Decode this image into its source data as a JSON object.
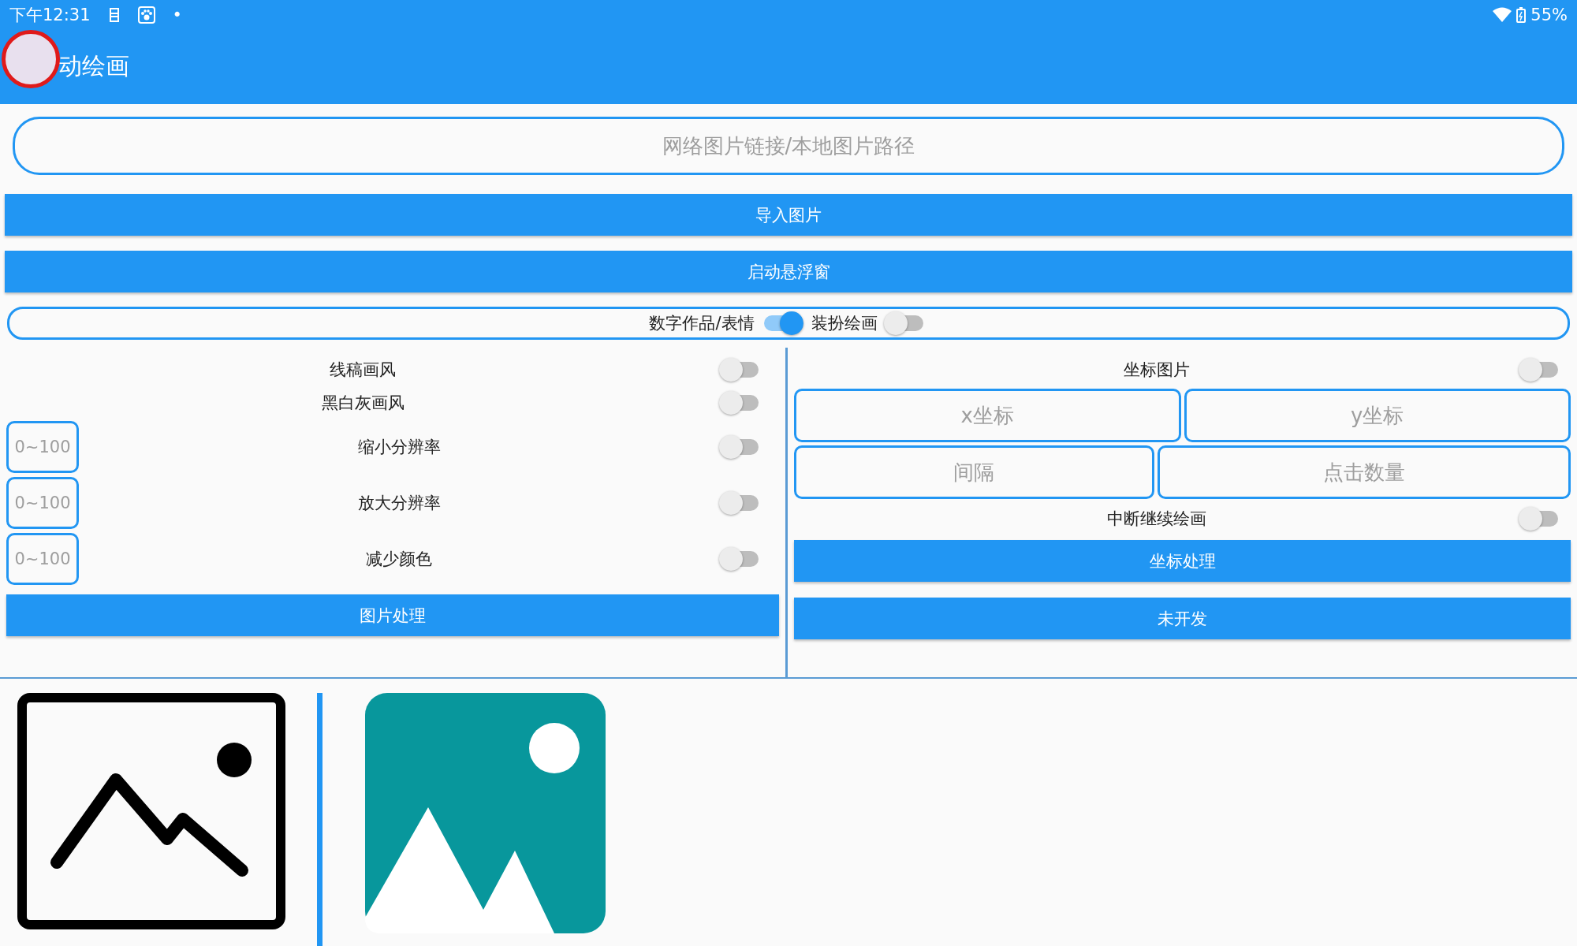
{
  "status_bar": {
    "time": "下午12:31",
    "dot": "•",
    "battery": "55%"
  },
  "app_bar": {
    "title": "动绘画"
  },
  "url_field": {
    "placeholder": "网络图片链接/本地图片路径"
  },
  "buttons": [
    "导入图片",
    "启动悬浮窗"
  ],
  "mode_row": [
    {
      "label": "数字作品/表情",
      "on": true
    },
    {
      "label": "装扮绘画",
      "on": false
    }
  ],
  "left_panel": {
    "rows": [
      {
        "kind": "switch",
        "label": "线稿画风",
        "on": false
      },
      {
        "kind": "switch",
        "label": "黑白灰画风",
        "on": false
      },
      {
        "kind": "input",
        "placeholder": "0~100",
        "label": "缩小分辨率",
        "on": false
      },
      {
        "kind": "input",
        "placeholder": "0~100",
        "label": "放大分辨率",
        "on": false
      },
      {
        "kind": "input",
        "placeholder": "0~100",
        "label": "减少颜色",
        "on": false
      }
    ],
    "button": "图片处理"
  },
  "right_panel": {
    "coord_image": {
      "label": "坐标图片",
      "on": false
    },
    "field_rows": [
      [
        {
          "placeholder": "x坐标"
        },
        {
          "placeholder": "y坐标"
        }
      ],
      [
        {
          "placeholder": "间隔"
        },
        {
          "placeholder": "点击数量"
        }
      ]
    ],
    "resume": {
      "label": "中断继续绘画",
      "on": false
    },
    "buttons": [
      "坐标处理",
      "未开发"
    ]
  }
}
